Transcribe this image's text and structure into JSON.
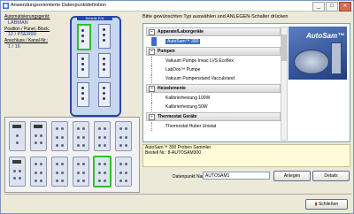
{
  "window": {
    "title": "Anwendungsorientierte Datenpunktdefinition",
    "close_glyph": "✕",
    "min_glyph": "_",
    "max_glyph": "□"
  },
  "info": {
    "device_label": "Automatisierungsgerät:",
    "device_value": "LABMAN",
    "position_label": "Position / Panel, Block:",
    "position_value": "12 / PSER99",
    "anschluss_label": "Anschluss / Kanal-Nr.:",
    "anschluss_value": "1 / 16"
  },
  "device_image": {
    "label": "Serielle E/A"
  },
  "instruction": "Bitte gewünschten Typ auswählen und ANLEGEN-Schalter drücken",
  "tree": {
    "categories": [
      {
        "label": "Apparate/Laborgeräte",
        "items": [
          "AutoSam™ 300"
        ]
      },
      {
        "label": "Pumpen",
        "items": [
          "Vakuum Pumpe Invac LVS Ecoflex",
          "LabDos™ Pumpe",
          "Vakuum Pumpenstand Vaccubrand"
        ]
      },
      {
        "label": "Heizelemente",
        "items": [
          "Kalibrierheizung 100W",
          "Kalibrierheizung 50W"
        ]
      },
      {
        "label": "Thermostat Geräte",
        "items": [
          "Thermostat Huber Unistat"
        ]
      }
    ],
    "selected_item": "AutoSam™ 300"
  },
  "preview": {
    "brand": "AutoSam™"
  },
  "description": {
    "line1": "AutoSam™ 300 Proben Sammler",
    "line2": "Bestell Nr.: 8-AUTOSAM300"
  },
  "datapoint": {
    "label": "Datenpunkt Name:",
    "value": "AUTOSAM1"
  },
  "buttons": {
    "anlegen": "Anlegen",
    "details": "Details",
    "schliessen": "Schließen"
  },
  "colors": {
    "accent": "#2647a8",
    "selection": "#3a6ccc",
    "highlight_green": "#2fbf2f"
  }
}
